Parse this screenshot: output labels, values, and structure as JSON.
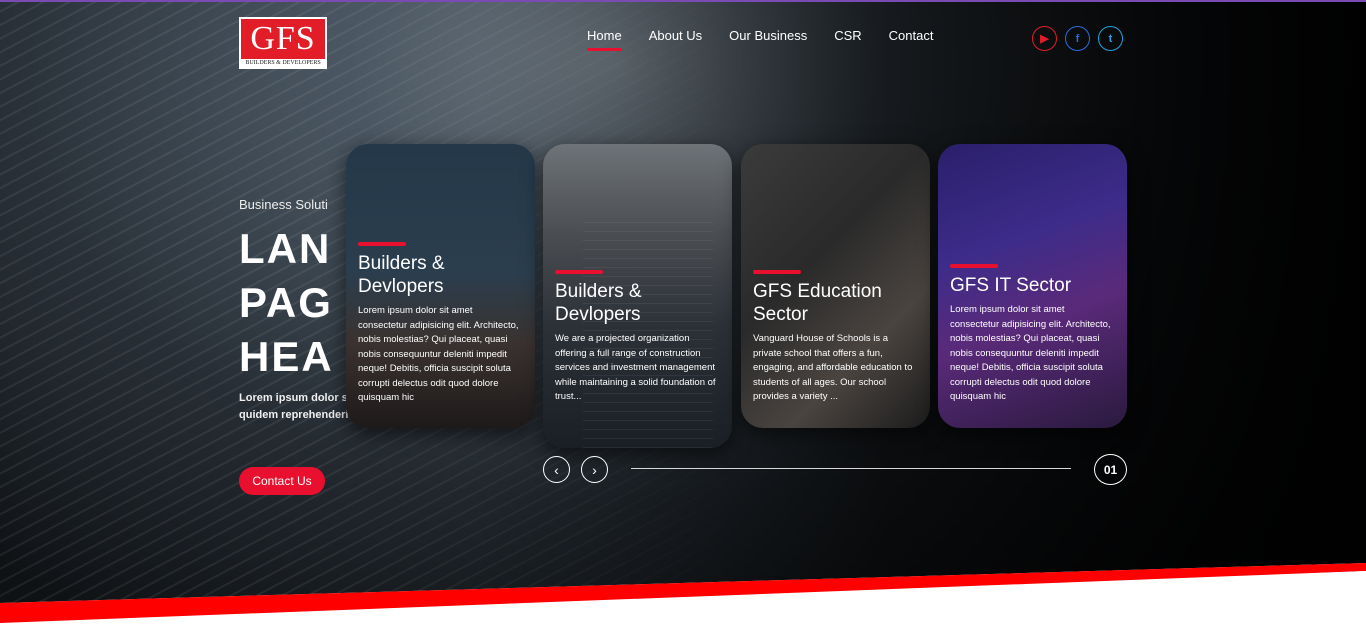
{
  "header": {
    "logo_text": "GFS",
    "logo_sub": "BUILDERS & DEVELOPERS",
    "nav": [
      {
        "label": "Home",
        "active": true
      },
      {
        "label": "About Us",
        "active": false
      },
      {
        "label": "Our Business",
        "active": false
      },
      {
        "label": "CSR",
        "active": false
      },
      {
        "label": "Contact",
        "active": false
      }
    ],
    "social": [
      {
        "icon": "youtube-icon",
        "glyph": "▶",
        "color": "#e31d28"
      },
      {
        "icon": "facebook-icon",
        "glyph": "f",
        "color": "#2d6cdf"
      },
      {
        "icon": "twitter-icon",
        "glyph": "t",
        "color": "#21a3e0"
      }
    ]
  },
  "hero": {
    "subtitle": "Business Soluti",
    "title_lines": [
      "LAN",
      "PAG",
      "HEA"
    ],
    "description": "Lorem ipsum dolor sit Assumenda nam odit quidem reprehenderit, at iure error",
    "contact_label": "Contact Us"
  },
  "cards": [
    {
      "title": "Builders & Devlopers",
      "text": "Lorem ipsum dolor sit amet consectetur adipisicing elit. Architecto, nobis molestias? Qui placeat, quasi nobis consequuntur deleniti impedit neque! Debitis, officia suscipit soluta corrupti delectus odit quod dolore quisquam hic"
    },
    {
      "title": "Builders & Devlopers",
      "text": "We are a projected organization offering a full range of construction services and investment management while maintaining a solid foundation of trust..."
    },
    {
      "title": "GFS Education Sector",
      "text": "Vanguard House of Schools is a private school that offers a fun, engaging, and affordable education to students of all ages. Our school provides a variety ..."
    },
    {
      "title": "GFS IT Sector",
      "text": "Lorem ipsum dolor sit amet consectetur adipisicing elit. Architecto, nobis molestias? Qui placeat, quasi nobis consequuntur deleniti impedit neque! Debitis, officia suscipit soluta corrupti delectus odit quod dolore quisquam hic"
    }
  ],
  "slider": {
    "prev_icon": "‹",
    "next_icon": "›",
    "current": "01"
  },
  "colors": {
    "accent_red": "#e8102e",
    "logo_red": "#e31d28"
  }
}
